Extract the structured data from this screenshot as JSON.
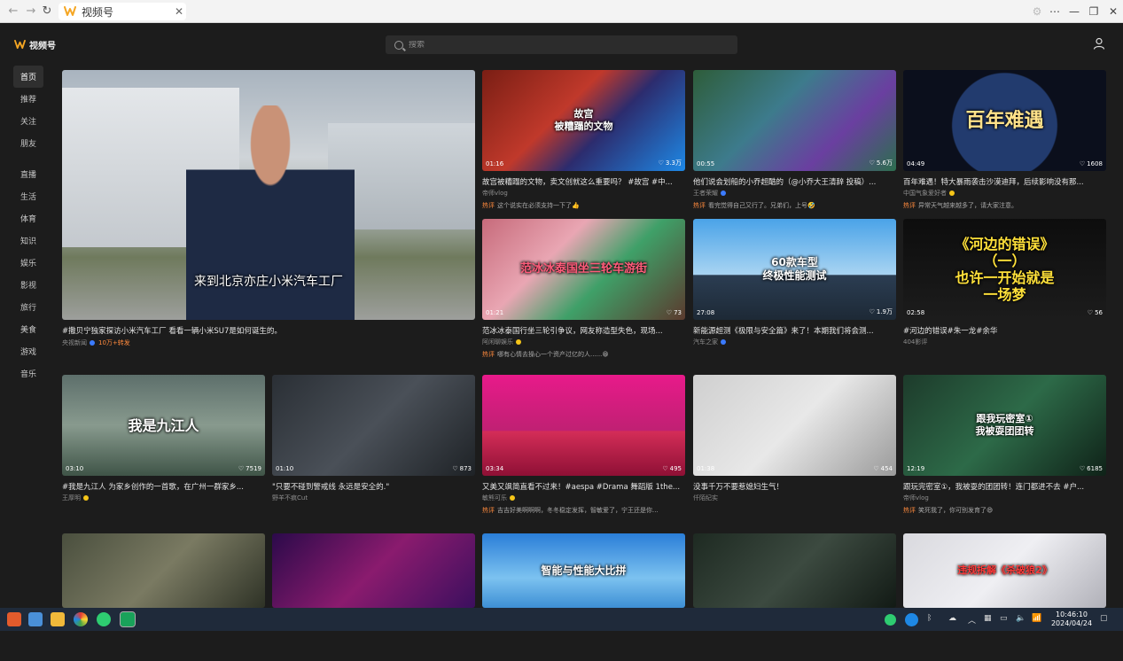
{
  "browser": {
    "tab_title": "视频号",
    "close_glyph": "✕",
    "back_glyph": "←",
    "forward_glyph": "→",
    "reload_glyph": "↻",
    "menu_glyph": "⋯",
    "min_glyph": "—",
    "max_glyph": "❐",
    "winclose_glyph": "✕"
  },
  "app": {
    "name": "视频号",
    "search_placeholder": "搜索",
    "accent": "#ff8a3d"
  },
  "sidebar": {
    "items": [
      {
        "label": "首页"
      },
      {
        "label": "推荐"
      },
      {
        "label": "关注"
      },
      {
        "label": "朋友"
      },
      {
        "label": "直播"
      },
      {
        "label": "生活"
      },
      {
        "label": "体育"
      },
      {
        "label": "知识"
      },
      {
        "label": "娱乐"
      },
      {
        "label": "影视"
      },
      {
        "label": "旅行"
      },
      {
        "label": "美食"
      },
      {
        "label": "游戏"
      },
      {
        "label": "音乐"
      }
    ]
  },
  "featured": {
    "caption": "来到北京亦庄小米汽车工厂",
    "title": "#撒贝宁独家探访小米汽车工厂 看看一辆小米SU7是如何诞生的。",
    "author": "央视新闻",
    "extra": "10万+转发"
  },
  "cards": [
    {
      "caption": "故宫\n被糟蹋的文物",
      "duration": "01:16",
      "likes": "3.3万",
      "title": "故宫被糟蹋的文物，卖文创就这么重要吗？ #故宫 #中...",
      "author": "帝师vlog",
      "hot_label": "热评",
      "hot": "这个说实在必须支持一下了👍"
    },
    {
      "caption": "",
      "duration": "00:55",
      "likes": "5.6万",
      "title": "他们说会划船的小乔超酷的（@小乔大王清辞 投稿）...",
      "author": "王者荣耀",
      "hot_label": "热评",
      "hot": "看完觉得自己又行了。兄弟们，上号🤣"
    },
    {
      "caption": "百年难遇",
      "duration": "04:49",
      "likes": "1608",
      "title": "百年难遇！特大暴雨袭击沙漠迪拜，后续影响没有那...",
      "author": "中国气象爱好者",
      "hot_label": "热评",
      "hot": "异常天气越来越多了，请大家注意。"
    },
    {
      "caption": "范冰冰泰国坐三轮车游街",
      "duration": "01:21",
      "likes": "73",
      "title": "范冰冰泰国行坐三轮引争议，网友称造型失色，现场...",
      "author": "阿闲聊娱乐",
      "hot_label": "热评",
      "hot": "哪有心情去操心一个资产过亿的人......😁"
    },
    {
      "caption": "60款车型\n终极性能测试",
      "duration": "27:08",
      "likes": "1.9万",
      "title": "新能源超测《极限与安全篇》来了！本期我们将会测...",
      "author": "汽车之家",
      "hot_label": "",
      "hot": ""
    },
    {
      "caption": "《河边的错误》\n（一）\n也许一开始就是\n一场梦",
      "duration": "02:58",
      "likes": "56",
      "title": "#河边的错误#朱一龙#余华",
      "author": "404影评",
      "hot_label": "",
      "hot": ""
    },
    {
      "caption": "我是九江人",
      "duration": "03:10",
      "likes": "7519",
      "title": "#我是九江人 为家乡创作的一首歌，在广州一群家乡...",
      "author": "王厚明",
      "hot_label": "",
      "hot": ""
    },
    {
      "caption": "",
      "duration": "01:10",
      "likes": "873",
      "title": "\"只要不碰到警戒线 永远是安全的.\"",
      "author": "野羊不疯Cut",
      "hot_label": "",
      "hot": ""
    },
    {
      "caption": "",
      "duration": "03:34",
      "likes": "495",
      "title": "又美又飒简直看不过来！#aespa #Drama 舞蹈版 1the...",
      "author": "敏熊可乐",
      "hot_label": "热评",
      "hot": "吉吉好美啊啊啊，冬冬稳定发挥，智敏爱了，宁王还是你..."
    },
    {
      "caption": "",
      "duration": "01:38",
      "likes": "454",
      "title": "没事千万不要惹媳妇生气！",
      "author": "仟陌纪实",
      "hot_label": "",
      "hot": ""
    },
    {
      "caption": "跟我玩密室①\n我被耍团团转",
      "duration": "12:19",
      "likes": "6185",
      "title": "跟玩完密室①，我被耍的团团转！连门都进不去 #户...",
      "author": "帝师vlog",
      "hot_label": "热评",
      "hot": "笑死我了，你可别发育了😄"
    },
    {
      "caption": "",
      "duration": "",
      "likes": "",
      "title": "",
      "author": "",
      "hot_label": "",
      "hot": ""
    },
    {
      "caption": "",
      "duration": "",
      "likes": "",
      "title": "",
      "author": "",
      "hot_label": "",
      "hot": ""
    },
    {
      "caption": "智能与性能大比拼",
      "duration": "",
      "likes": "",
      "title": "",
      "author": "",
      "hot_label": "",
      "hot": ""
    },
    {
      "caption": "",
      "duration": "",
      "likes": "",
      "title": "",
      "author": "",
      "hot_label": "",
      "hot": ""
    },
    {
      "caption": "违规拆解《杀破狼2》",
      "duration": "",
      "likes": "",
      "title": "",
      "author": "",
      "hot_label": "",
      "hot": ""
    }
  ],
  "taskbar": {
    "time": "10:46:10",
    "date": "2024/04/24"
  }
}
